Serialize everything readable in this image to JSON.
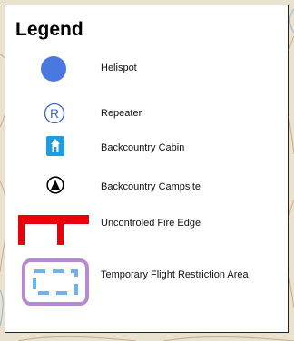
{
  "legend": {
    "title": "Legend",
    "items": [
      {
        "label": "Helispot",
        "icon": "helispot-icon",
        "color": "#4a78e0"
      },
      {
        "label": "Repeater",
        "icon": "repeater-icon",
        "glyph": "R",
        "color": "#3b64d0"
      },
      {
        "label": "Backcountry Cabin",
        "icon": "backcountry-cabin-icon",
        "color": "#1f9be0"
      },
      {
        "label": "Backcountry Campsite",
        "icon": "backcountry-campsite-icon",
        "color": "#000000"
      },
      {
        "label": "Uncontroled Fire Edge",
        "icon": "fire-edge-icon",
        "color": "#e8000b"
      },
      {
        "label": "Temporary Flight Restriction Area",
        "icon": "flight-restriction-icon",
        "color": "#b58ad0",
        "inner_color": "#6fb2f2"
      }
    ]
  }
}
